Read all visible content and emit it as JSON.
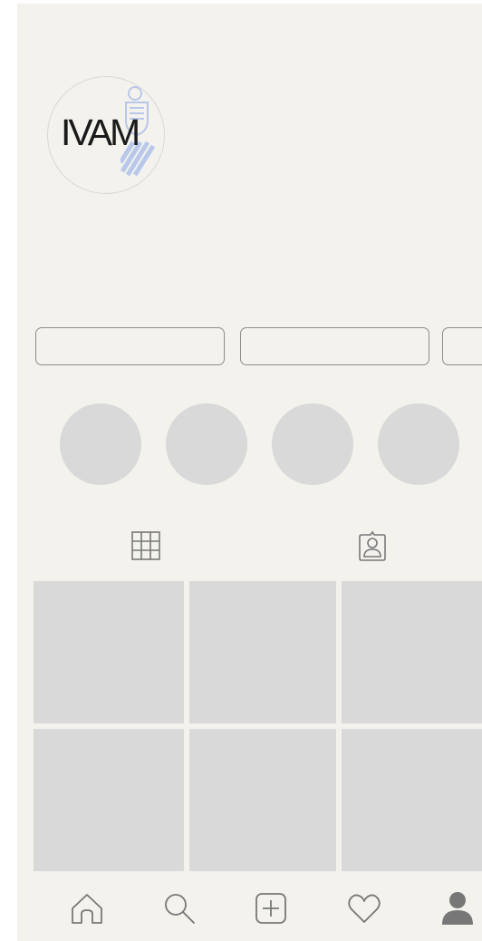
{
  "profile": {
    "avatar_text": "IVAM"
  },
  "colors": {
    "background": "#f3f2ed",
    "placeholder": "#d9d9d9",
    "outline": "#8c8c8c",
    "icon": "#777777",
    "crest": "#b9c8ea"
  },
  "buttons": [
    "blank-button-1",
    "blank-button-2",
    "blank-button-3"
  ],
  "tabs": [
    {
      "icon": "grid-icon"
    },
    {
      "icon": "tagged-person-icon"
    }
  ],
  "bottom_nav": [
    {
      "icon": "home-icon"
    },
    {
      "icon": "search-icon"
    },
    {
      "icon": "add-post-icon"
    },
    {
      "icon": "heart-icon"
    },
    {
      "icon": "profile-icon"
    }
  ]
}
